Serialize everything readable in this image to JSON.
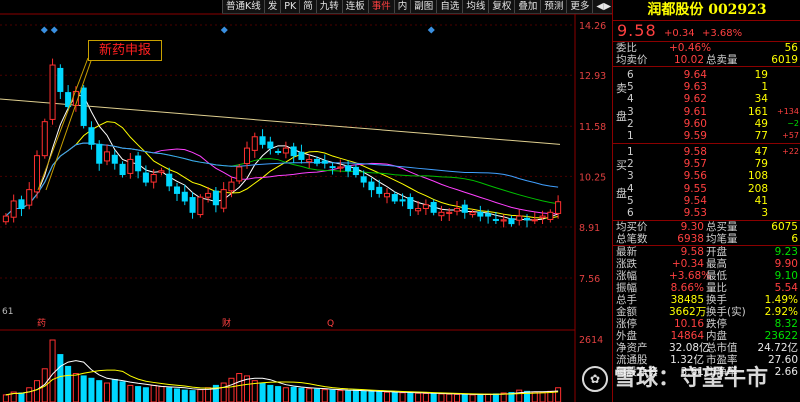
{
  "toolbar": {
    "items": [
      "普通K线",
      "发",
      "PK",
      "简",
      "九转",
      "连板",
      "事件",
      "内",
      "副图",
      "自选",
      "均线",
      "复权",
      "叠加",
      "预测",
      "更多",
      "◀▶"
    ],
    "selected": "事件"
  },
  "chart_data": {
    "type": "candlestick",
    "price_axis": {
      "ticks": [
        "14.26",
        "12.93",
        "11.58",
        "10.25",
        "8.91",
        "7.56"
      ],
      "min": 7.56,
      "max": 14.26
    },
    "volume_axis": {
      "ticks": [
        "2614"
      ]
    },
    "left_label": "61",
    "annotation": "新药申报",
    "event_markers": [
      "药",
      "财",
      "Q"
    ],
    "closes": [
      9.2,
      9.6,
      9.4,
      9.9,
      10.8,
      11.7,
      13.2,
      12.5,
      12.1,
      12.5,
      11.6,
      11.1,
      10.6,
      10.9,
      10.6,
      10.3,
      10.7,
      10.4,
      10.1,
      10.3,
      10.4,
      10.0,
      9.8,
      9.6,
      9.3,
      9.7,
      9.8,
      9.5,
      9.9,
      10.1,
      10.5,
      11.0,
      11.3,
      11.1,
      11.0,
      10.9,
      11.0,
      10.8,
      10.7,
      10.7,
      10.6,
      10.6,
      10.5,
      10.5,
      10.4,
      10.3,
      10.1,
      9.9,
      9.8,
      9.8,
      9.6,
      9.6,
      9.4,
      9.4,
      9.5,
      9.3,
      9.3,
      9.3,
      9.4,
      9.3,
      9.3,
      9.2,
      9.2,
      9.1,
      9.1,
      9.0,
      9.2,
      9.1,
      9.1,
      9.2,
      9.3,
      9.58
    ],
    "volumes": [
      300,
      420,
      380,
      600,
      900,
      1400,
      2614,
      2000,
      1500,
      1200,
      1100,
      1000,
      900,
      800,
      950,
      850,
      700,
      650,
      600,
      700,
      650,
      600,
      550,
      500,
      480,
      520,
      600,
      700,
      800,
      1000,
      1200,
      1100,
      900,
      800,
      700,
      650,
      600,
      620,
      580,
      560,
      540,
      520,
      500,
      480,
      460,
      500,
      450,
      430,
      420,
      410,
      400,
      390,
      380,
      370,
      360,
      350,
      340,
      330,
      320,
      310,
      300,
      320,
      330,
      340,
      380,
      400,
      500,
      450,
      420,
      400,
      450,
      600
    ]
  },
  "panel": {
    "title": "润都股份 002923",
    "price": "9.58",
    "change": "+0.34",
    "change_pct": "+3.68%",
    "wei": [
      {
        "label": "委比",
        "value": "+0.46%",
        "label2": "",
        "value2": "56"
      },
      {
        "label": "均卖价",
        "value": "10.02",
        "label2": "总卖量",
        "value2": "6019"
      }
    ],
    "sell_side": "卖盘",
    "buy_side": "买盘",
    "sell": [
      {
        "lv": "6",
        "price": "9.64",
        "vol": "19",
        "ch": ""
      },
      {
        "lv": "5",
        "price": "9.63",
        "vol": "1",
        "ch": ""
      },
      {
        "lv": "4",
        "price": "9.62",
        "vol": "34",
        "ch": ""
      },
      {
        "lv": "3",
        "price": "9.61",
        "vol": "161",
        "ch": "+134"
      },
      {
        "lv": "2",
        "price": "9.60",
        "vol": "49",
        "ch": "−2"
      },
      {
        "lv": "1",
        "price": "9.59",
        "vol": "77",
        "ch": "+57"
      }
    ],
    "buy": [
      {
        "lv": "1",
        "price": "9.58",
        "vol": "47",
        "ch": "+22"
      },
      {
        "lv": "2",
        "price": "9.57",
        "vol": "79",
        "ch": ""
      },
      {
        "lv": "3",
        "price": "9.56",
        "vol": "108",
        "ch": ""
      },
      {
        "lv": "4",
        "price": "9.55",
        "vol": "208",
        "ch": ""
      },
      {
        "lv": "5",
        "price": "9.54",
        "vol": "41",
        "ch": ""
      },
      {
        "lv": "6",
        "price": "9.53",
        "vol": "3",
        "ch": ""
      }
    ],
    "totals": [
      {
        "label": "均买价",
        "value": "9.30",
        "label2": "总买量",
        "value2": "6075"
      },
      {
        "label": "总笔数",
        "value": "6938",
        "label2": "均笔量",
        "value2": "6"
      }
    ],
    "quote": [
      {
        "l1": "最新",
        "v1": "9.58",
        "c1": "red",
        "l2": "开盘",
        "v2": "9.23",
        "c2": "green"
      },
      {
        "l1": "涨跌",
        "v1": "+0.34",
        "c1": "red",
        "l2": "最高",
        "v2": "9.90",
        "c2": "red"
      },
      {
        "l1": "涨幅",
        "v1": "+3.68%",
        "c1": "red",
        "l2": "最低",
        "v2": "9.10",
        "c2": "green"
      },
      {
        "l1": "振幅",
        "v1": "8.66%",
        "c1": "red",
        "l2": "量比",
        "v2": "5.54",
        "c2": "red"
      },
      {
        "l1": "总手",
        "v1": "38485",
        "c1": "yel",
        "l2": "换手",
        "v2": "1.49%",
        "c2": "yel"
      },
      {
        "l1": "金额",
        "v1": "3662万",
        "c1": "yel",
        "l2": "换手(实)",
        "v2": "2.92%",
        "c2": "yel"
      },
      {
        "l1": "涨停",
        "v1": "10.16",
        "c1": "red",
        "l2": "跌停",
        "v2": "8.32",
        "c2": "green"
      },
      {
        "l1": "外盘",
        "v1": "14864",
        "c1": "red",
        "l2": "内盘",
        "v2": "23622",
        "c2": "green"
      },
      {
        "l1": "净资产",
        "v1": "32.08亿",
        "c1": "wht",
        "l2": "总市值",
        "v2": "24.72亿",
        "c2": "wht"
      },
      {
        "l1": "流通股",
        "v1": "1.32亿",
        "c1": "wht",
        "l2": "市盈率",
        "v2": "27.60",
        "c2": "wht"
      },
      {
        "l1": "每股净资",
        "v1": "3.61",
        "c1": "wht",
        "l2": "市净率",
        "v2": "2.66",
        "c2": "wht"
      }
    ]
  },
  "watermark": {
    "text": "雪球：守望牛市",
    "icon": "✿"
  }
}
